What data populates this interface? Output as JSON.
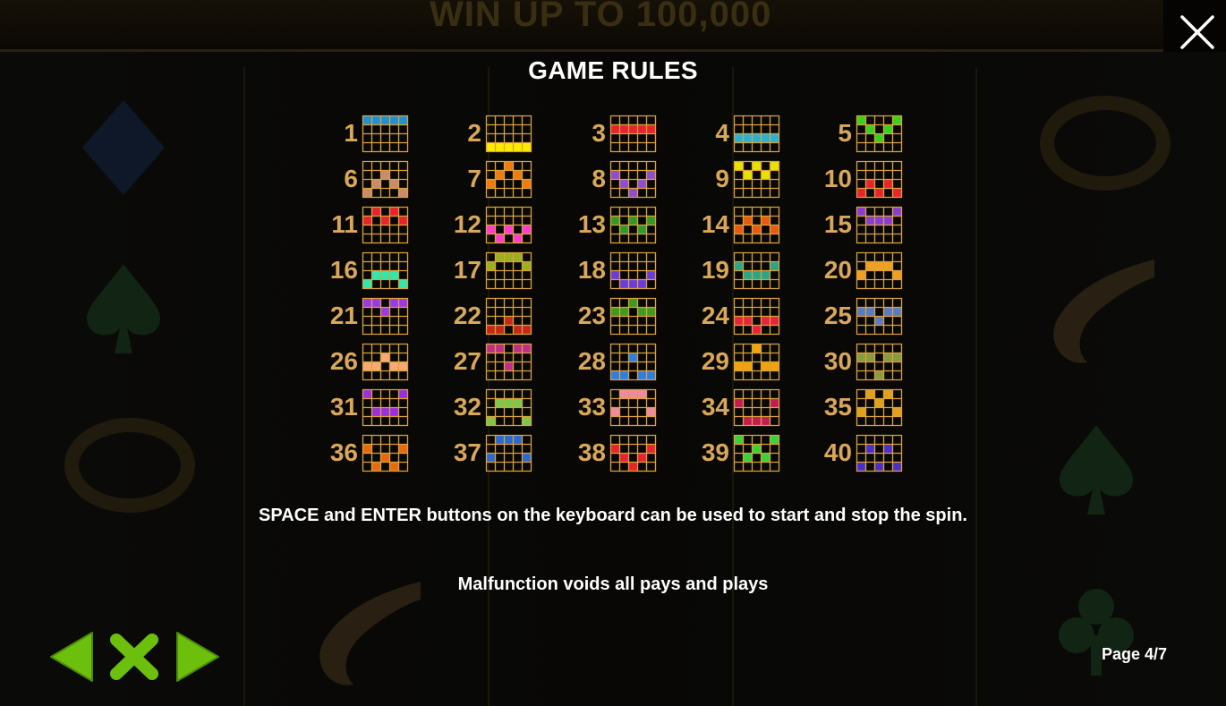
{
  "background": {
    "banner_text": "WIN UP TO 100,000"
  },
  "title": "GAME RULES",
  "close_icon": "close-icon",
  "accent_color": "#7dc011",
  "number_color": "#d9a758",
  "grid_color": "#d9a23b",
  "paylines": [
    {
      "n": "1",
      "color": "#1f8fd6",
      "rows": [
        0,
        0,
        0,
        0,
        0
      ]
    },
    {
      "n": "2",
      "color": "#ffea00",
      "rows": [
        3,
        3,
        3,
        3,
        3
      ]
    },
    {
      "n": "3",
      "color": "#e8232c",
      "rows": [
        1,
        1,
        1,
        1,
        1
      ]
    },
    {
      "n": "4",
      "color": "#27b3d6",
      "rows": [
        2,
        2,
        2,
        2,
        2
      ]
    },
    {
      "n": "5",
      "color": "#35d21f",
      "rows": [
        0,
        1,
        2,
        1,
        0
      ]
    },
    {
      "n": "6",
      "color": "#c98a70",
      "rows": [
        3,
        2,
        1,
        2,
        3
      ]
    },
    {
      "n": "7",
      "color": "#f07a11",
      "rows": [
        2,
        1,
        0,
        1,
        2
      ]
    },
    {
      "n": "8",
      "color": "#8e4cd6",
      "rows": [
        1,
        2,
        3,
        2,
        1
      ]
    },
    {
      "n": "9",
      "color": "#e8e200",
      "rows": [
        0,
        1,
        0,
        1,
        0
      ]
    },
    {
      "n": "10",
      "color": "#e8232c",
      "rows": [
        3,
        2,
        3,
        2,
        3
      ]
    },
    {
      "n": "11",
      "color": "#e8232c",
      "rows": [
        1,
        0,
        1,
        0,
        1
      ]
    },
    {
      "n": "12",
      "color": "#ff3bd0",
      "rows": [
        2,
        3,
        2,
        3,
        2
      ]
    },
    {
      "n": "13",
      "color": "#2e9a2a",
      "rows": [
        1,
        2,
        1,
        2,
        1
      ]
    },
    {
      "n": "14",
      "color": "#e85a12",
      "rows": [
        2,
        1,
        2,
        1,
        2
      ]
    },
    {
      "n": "15",
      "color": "#8a3cd6",
      "rows": [
        0,
        1,
        1,
        1,
        0
      ]
    },
    {
      "n": "16",
      "color": "#2de8b0",
      "rows": [
        3,
        2,
        2,
        2,
        3
      ]
    },
    {
      "n": "17",
      "color": "#9ab01f",
      "rows": [
        1,
        0,
        0,
        0,
        1
      ]
    },
    {
      "n": "18",
      "color": "#6a3ce0",
      "rows": [
        2,
        3,
        3,
        3,
        2
      ]
    },
    {
      "n": "19",
      "color": "#2aa58a",
      "rows": [
        1,
        2,
        2,
        2,
        1
      ]
    },
    {
      "n": "20",
      "color": "#f0a020",
      "rows": [
        2,
        1,
        1,
        1,
        2
      ]
    },
    {
      "n": "21",
      "color": "#9b38e8",
      "rows": [
        0,
        0,
        1,
        0,
        0
      ]
    },
    {
      "n": "22",
      "color": "#c4281a",
      "rows": [
        3,
        3,
        2,
        3,
        3
      ]
    },
    {
      "n": "23",
      "color": "#3f9a20",
      "rows": [
        1,
        1,
        0,
        1,
        1
      ]
    },
    {
      "n": "24",
      "color": "#e8233e",
      "rows": [
        2,
        2,
        3,
        2,
        2
      ]
    },
    {
      "n": "25",
      "color": "#5a7ac4",
      "rows": [
        1,
        1,
        2,
        1,
        1
      ]
    },
    {
      "n": "26",
      "color": "#f7a877",
      "rows": [
        2,
        2,
        1,
        2,
        2
      ]
    },
    {
      "n": "27",
      "color": "#c02e8c",
      "rows": [
        0,
        0,
        2,
        0,
        0
      ]
    },
    {
      "n": "28",
      "color": "#2e7ee0",
      "rows": [
        3,
        3,
        1,
        3,
        3
      ]
    },
    {
      "n": "29",
      "color": "#f0a30e",
      "rows": [
        2,
        2,
        0,
        2,
        2
      ]
    },
    {
      "n": "30",
      "color": "#8a9a40",
      "rows": [
        1,
        1,
        3,
        1,
        1
      ]
    },
    {
      "n": "31",
      "color": "#9a2ee0",
      "rows": [
        0,
        2,
        2,
        2,
        0
      ]
    },
    {
      "n": "32",
      "color": "#7cc84a",
      "rows": [
        3,
        1,
        1,
        1,
        3
      ]
    },
    {
      "n": "33",
      "color": "#f08aa2",
      "rows": [
        2,
        0,
        0,
        0,
        2
      ]
    },
    {
      "n": "34",
      "color": "#c21c56",
      "rows": [
        1,
        3,
        3,
        3,
        1
      ]
    },
    {
      "n": "35",
      "color": "#e0a01e",
      "rows": [
        2,
        0,
        1,
        0,
        2
      ]
    },
    {
      "n": "36",
      "color": "#e86a10",
      "rows": [
        1,
        3,
        2,
        3,
        1
      ]
    },
    {
      "n": "37",
      "color": "#2a6ad0",
      "rows": [
        2,
        0,
        0,
        0,
        2
      ]
    },
    {
      "n": "38",
      "color": "#e8232c",
      "rows": [
        1,
        2,
        3,
        2,
        1
      ]
    },
    {
      "n": "39",
      "color": "#38d23a",
      "rows": [
        0,
        2,
        1,
        2,
        0
      ]
    },
    {
      "n": "40",
      "color": "#4a2ed0",
      "rows": [
        3,
        1,
        3,
        1,
        3
      ]
    }
  ],
  "text_keyboard": "SPACE and ENTER buttons on the keyboard can be used to start and stop the spin.",
  "text_malfunction": "Malfunction voids all pays and plays",
  "nav": {
    "prev_icon": "arrow-left-icon",
    "close_icon": "close-x-icon",
    "next_icon": "arrow-right-icon"
  },
  "page_indicator": "Page 4/7"
}
